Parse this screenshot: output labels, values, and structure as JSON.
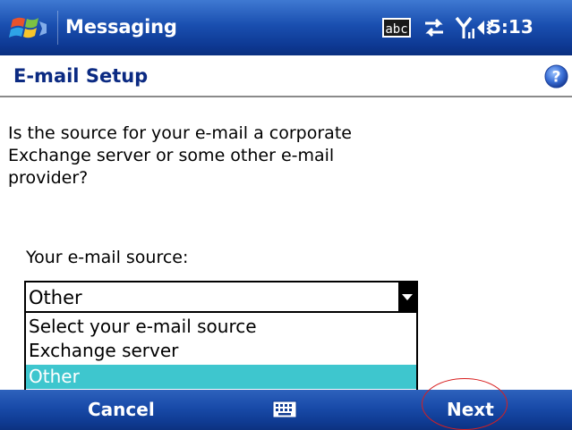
{
  "titlebar": {
    "app_title": "Messaging",
    "status_icons": [
      "input-method-icon",
      "connectivity-icon",
      "signal-strength-icon",
      "volume-icon"
    ],
    "time": "5:13"
  },
  "header": {
    "title": "E-mail Setup",
    "help_icon": "help-icon"
  },
  "main": {
    "question": "Is the source for your e-mail a corporate Exchange server or some other e-mail provider?",
    "source_label": "Your e-mail source:",
    "select": {
      "value": "Other",
      "options": [
        "Select your e-mail source",
        "Exchange server",
        "Other"
      ],
      "selected_index": 2
    }
  },
  "softkeys": {
    "left": "Cancel",
    "center_icon": "keyboard-icon",
    "right": "Next"
  },
  "colors": {
    "titlebar": "#1a4fb0",
    "header_text": "#0b2a82",
    "selection": "#3ec6ce",
    "annotation": "#d81f1f"
  }
}
